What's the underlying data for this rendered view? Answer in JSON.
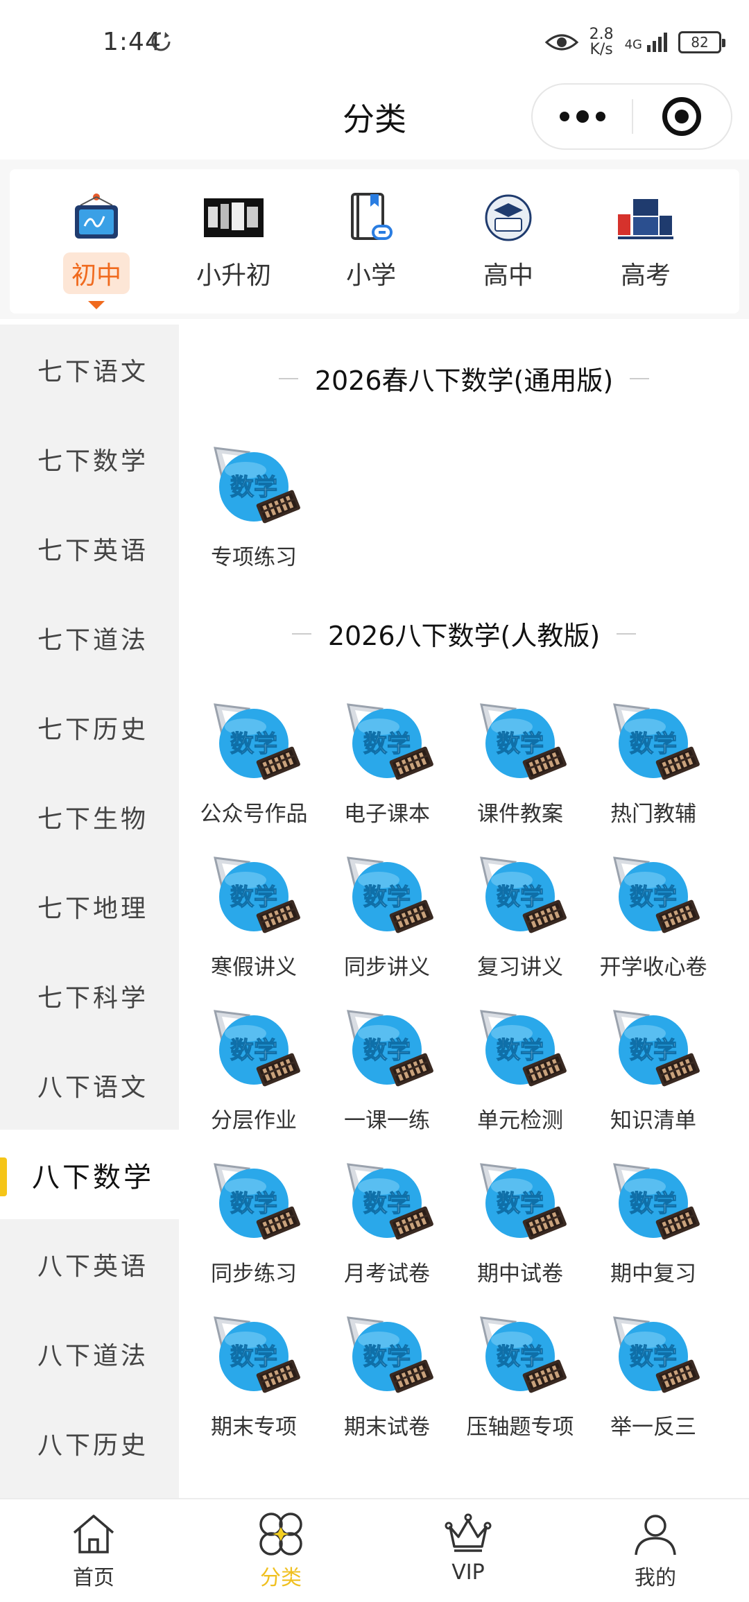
{
  "status_bar": {
    "time": "1:44",
    "speed_value": "2.8",
    "speed_unit": "K/s",
    "network": "4G",
    "battery": "82"
  },
  "title_bar": {
    "title": "分类"
  },
  "categories": [
    {
      "label": "初中",
      "icon": "monitor-icon",
      "active": true
    },
    {
      "label": "小升初",
      "icon": "poster-icon",
      "active": false
    },
    {
      "label": "小学",
      "icon": "book-link-icon",
      "active": false
    },
    {
      "label": "高中",
      "icon": "graduation-badge-icon",
      "active": false
    },
    {
      "label": "高考",
      "icon": "gaokao-logo-icon",
      "active": false
    }
  ],
  "sidebar": {
    "items": [
      {
        "label": "七下语文"
      },
      {
        "label": "七下数学"
      },
      {
        "label": "七下英语"
      },
      {
        "label": "七下道法"
      },
      {
        "label": "七下历史"
      },
      {
        "label": "七下生物"
      },
      {
        "label": "七下地理"
      },
      {
        "label": "七下科学"
      },
      {
        "label": "八下语文"
      },
      {
        "label": "八下数学"
      },
      {
        "label": "八下英语"
      },
      {
        "label": "八下道法"
      },
      {
        "label": "八下历史"
      }
    ],
    "active_index": 9
  },
  "content": {
    "icon_text": "数学",
    "sections": [
      {
        "title": "2026春八下数学(通用版)",
        "tiles": [
          {
            "label": "专项练习"
          }
        ]
      },
      {
        "title": "2026八下数学(人教版)",
        "tiles": [
          {
            "label": "公众号作品"
          },
          {
            "label": "电子课本"
          },
          {
            "label": "课件教案"
          },
          {
            "label": "热门教辅"
          },
          {
            "label": "寒假讲义"
          },
          {
            "label": "同步讲义"
          },
          {
            "label": "复习讲义"
          },
          {
            "label": "开学收心卷"
          },
          {
            "label": "分层作业"
          },
          {
            "label": "一课一练"
          },
          {
            "label": "单元检测"
          },
          {
            "label": "知识清单"
          },
          {
            "label": "同步练习"
          },
          {
            "label": "月考试卷"
          },
          {
            "label": "期中试卷"
          },
          {
            "label": "期中复习"
          },
          {
            "label": "期末专项"
          },
          {
            "label": "期末试卷"
          },
          {
            "label": "压轴题专项"
          },
          {
            "label": "举一反三"
          }
        ]
      }
    ]
  },
  "tab_bar": [
    {
      "label": "首页",
      "icon": "home-icon",
      "active": false
    },
    {
      "label": "分类",
      "icon": "category-icon",
      "active": true
    },
    {
      "label": "VIP",
      "icon": "crown-icon",
      "active": false
    },
    {
      "label": "我的",
      "icon": "user-icon",
      "active": false
    }
  ],
  "colors": {
    "accent_orange": "#f06a1e",
    "accent_yellow": "#f5c518",
    "icon_blue": "#2aa8ea"
  }
}
